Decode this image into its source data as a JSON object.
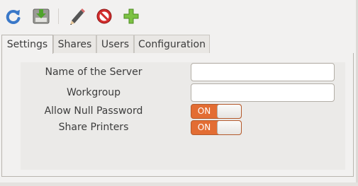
{
  "toolbar": {
    "buttons": [
      {
        "icon": "refresh-icon"
      },
      {
        "icon": "save-icon"
      },
      {
        "icon": "edit-icon"
      },
      {
        "icon": "delete-icon"
      },
      {
        "icon": "add-icon"
      }
    ]
  },
  "tabs": [
    {
      "label": "Settings",
      "active": true
    },
    {
      "label": "Shares",
      "active": false
    },
    {
      "label": "Users",
      "active": false
    },
    {
      "label": "Configuration",
      "active": false
    }
  ],
  "form": {
    "server_name_label": "Name of the Server",
    "server_name_value": "",
    "workgroup_label": "Workgroup",
    "workgroup_value": "",
    "allow_null_password_label": "Allow Null Password",
    "allow_null_password_state": "ON",
    "share_printers_label": "Share Printers",
    "share_printers_state": "ON"
  },
  "colors": {
    "switch_on": "#e36d33",
    "window_bg": "#f2f1f0"
  }
}
